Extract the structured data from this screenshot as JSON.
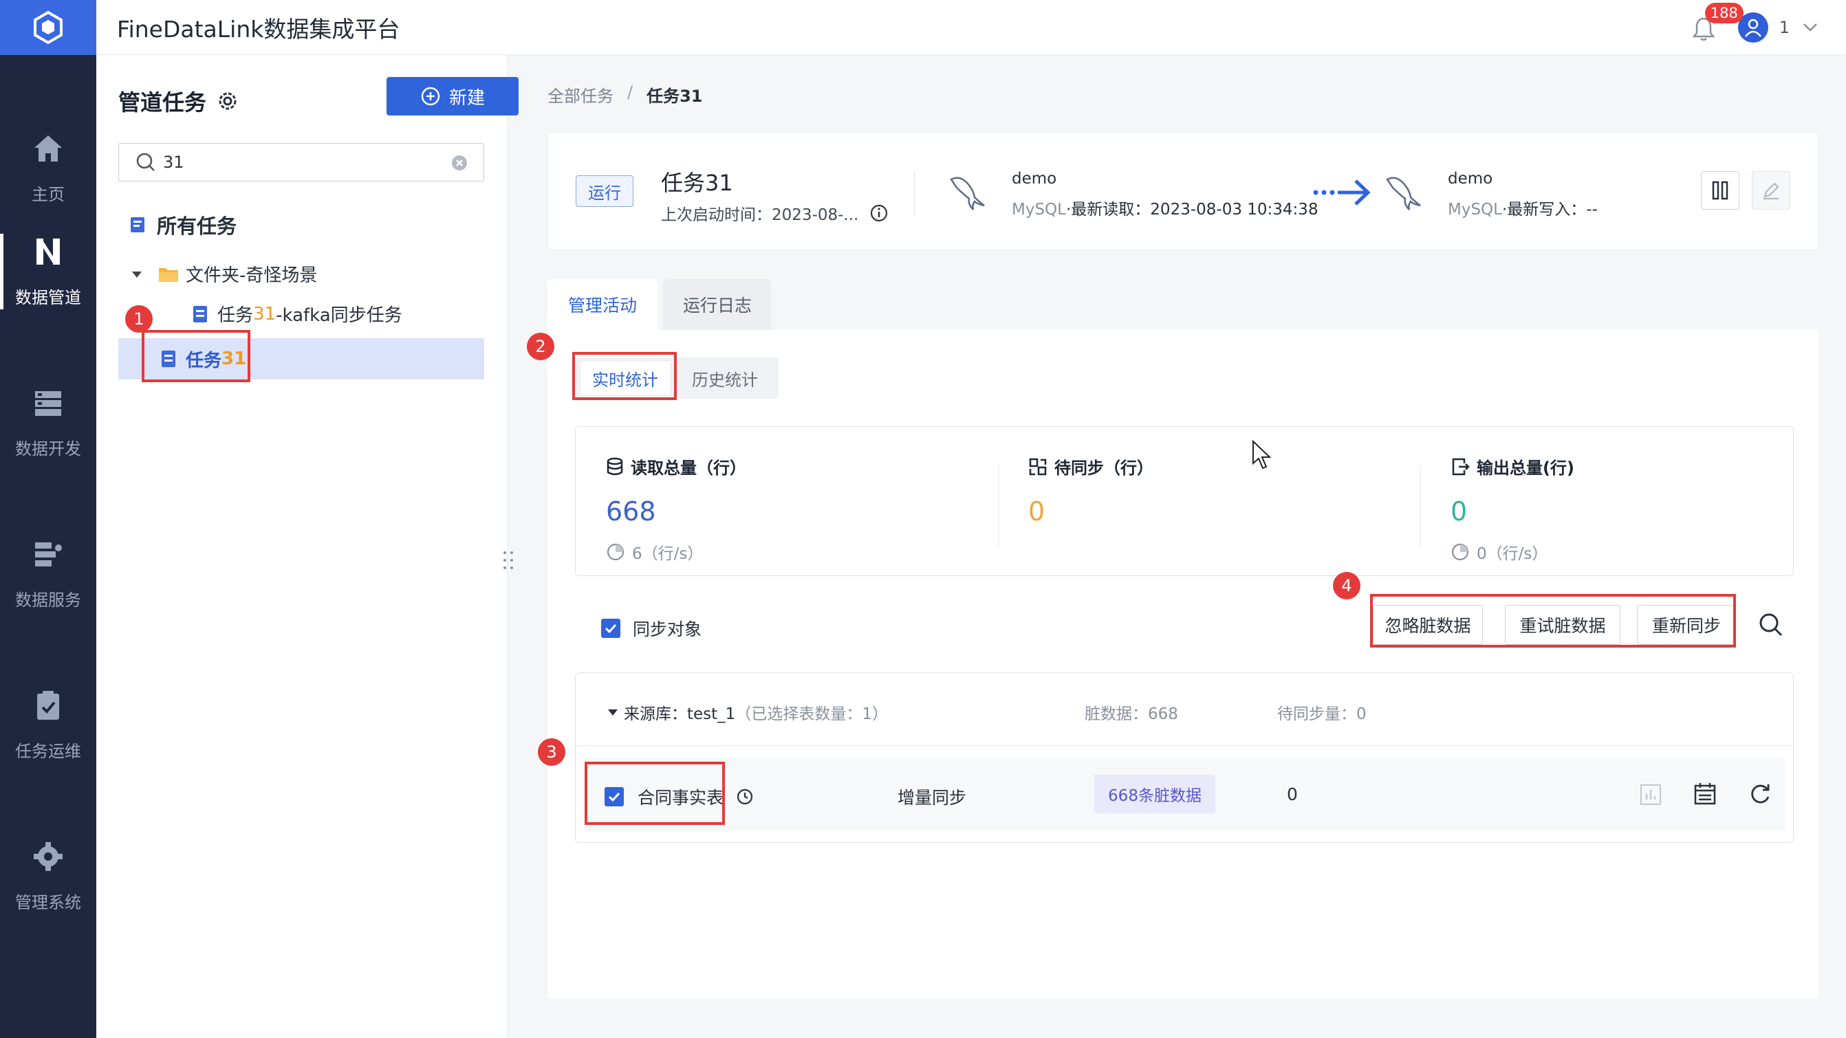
{
  "header": {
    "app_title": "FineDataLink数据集成平台",
    "notification_count": "188",
    "user_name": "1"
  },
  "nav": {
    "items": [
      {
        "label": "主页",
        "icon": "home-icon"
      },
      {
        "label": "数据管道",
        "icon": "pipeline-icon",
        "active": true
      },
      {
        "label": "数据开发",
        "icon": "dev-icon"
      },
      {
        "label": "数据服务",
        "icon": "service-icon"
      },
      {
        "label": "任务运维",
        "icon": "ops-icon"
      },
      {
        "label": "管理系统",
        "icon": "gear-icon"
      }
    ]
  },
  "tree": {
    "title": "管道任务",
    "new_label": "新建",
    "search_value": "31",
    "all_tasks": "所有任务",
    "folder": "文件夹-奇怪场景",
    "task_kafka_prefix": "任务",
    "task_kafka_hl": "31",
    "task_kafka_suffix": "-kafka同步任务",
    "task_selected_prefix": "任务",
    "task_selected_hl": "31"
  },
  "markers": [
    "1",
    "2",
    "3",
    "4"
  ],
  "breadcrumb": {
    "root": "全部任务",
    "sep": "/",
    "current": "任务31"
  },
  "task_card": {
    "status": "运行",
    "name": "任务31",
    "last_start": "上次启动时间：2023-08-...",
    "source": {
      "name": "demo",
      "type": "MySQL",
      "label": "·最新读取：",
      "value": "2023-08-03 10:34:38"
    },
    "target": {
      "name": "demo",
      "type": "MySQL",
      "label": "·最新写入：",
      "value": "--"
    }
  },
  "tabs": {
    "manage": "管理活动",
    "log": "运行日志"
  },
  "subtabs": {
    "realtime": "实时统计",
    "history": "历史统计"
  },
  "stats": {
    "read": {
      "label": "读取总量（行）",
      "value": "668",
      "rate": "6（行/s）"
    },
    "pending": {
      "label": "待同步（行）",
      "value": "0"
    },
    "output": {
      "label": "输出总量(行)",
      "value": "0",
      "rate": "0（行/s）"
    }
  },
  "sync": {
    "label": "同步对象",
    "ignore": "忽略脏数据",
    "retry": "重试脏数据",
    "resync": "重新同步"
  },
  "source_group": {
    "label": "来源库：test_1",
    "selected_count": "（已选择表数量：1）",
    "dirty_total": "脏数据：668",
    "pending_total": "待同步量：0"
  },
  "table_row": {
    "name": "合同事实表",
    "mode": "增量同步",
    "dirty": "668条脏数据",
    "pending": "0"
  },
  "colors": {
    "nav_bg": "#1f2740",
    "logo_bg": "#3968e0",
    "primary": "#2f64db",
    "annotation_red": "#e43a3a",
    "read_value": "#3b63c4",
    "pending_value": "#f2a43a",
    "output_value": "#2fb59a"
  }
}
